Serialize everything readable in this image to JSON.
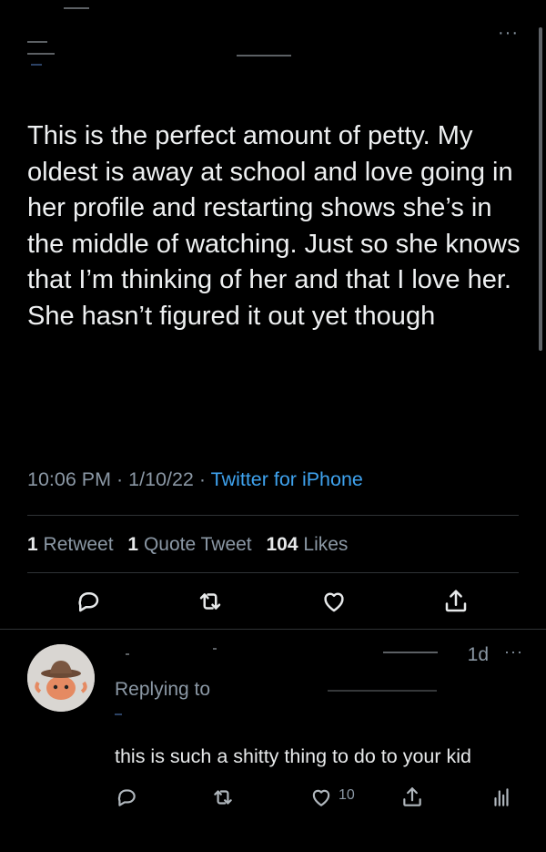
{
  "tweet": {
    "text": "This is the perfect amount of petty. My oldest is away at school and love going in her profile and restarting shows she’s in the middle of watching. Just so she knows that I’m thinking of her and that I love her. She hasn’t figured it out yet though",
    "time": "10:06 PM",
    "date": "1/10/22",
    "separator": " · ",
    "source": "Twitter for iPhone"
  },
  "stats": {
    "retweets_count": "1",
    "retweets_label": "Retweet",
    "quotes_count": "1",
    "quotes_label": "Quote Tweet",
    "likes_count": "104",
    "likes_label": "Likes"
  },
  "reply": {
    "time": "1d",
    "more": "···",
    "replying_label": "Replying to",
    "text": "this is such a shitty thing to do to your kid",
    "like_count": "10"
  },
  "header": {
    "more": "···"
  },
  "icons": {
    "main_actions": [
      "reply-icon",
      "retweet-icon",
      "like-icon",
      "share-icon"
    ],
    "reply_actions": [
      "reply-icon",
      "retweet-icon",
      "like-icon",
      "share-icon",
      "analytics-icon"
    ]
  },
  "colors": {
    "background": "#000000",
    "text": "#e7e9ea",
    "secondary": "#8b98a5",
    "link": "#3fa3ef",
    "divider": "#2f3336"
  }
}
